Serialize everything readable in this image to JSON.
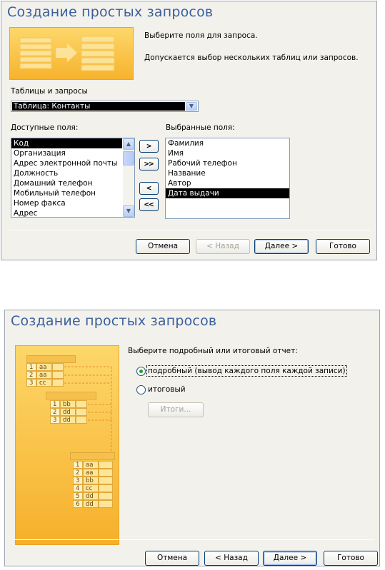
{
  "dialog1": {
    "title": "Создание простых запросов",
    "instruction1": "Выберите поля для запроса.",
    "instruction2": "Допускается выбор нескольких таблиц или запросов.",
    "tables_label": "Таблицы и запросы",
    "tables_value": "Таблица: Контакты",
    "available_label": "Доступные поля:",
    "selected_label": "Выбранные поля:",
    "available_fields": [
      "Код",
      "Организация",
      "Адрес электронной почты",
      "Должность",
      "Домашний телефон",
      "Мобильный телефон",
      "Номер факса",
      "Адрес"
    ],
    "selected_fields": [
      "Фамилия",
      "Имя",
      "Рабочий телефон",
      "Название",
      "Автор",
      "Дата выдачи"
    ],
    "move_buttons": [
      ">",
      ">>",
      "<",
      "<<"
    ],
    "buttons": {
      "cancel": "Отмена",
      "back": "< Назад",
      "next": "Далее >",
      "finish": "Готово"
    }
  },
  "dialog2": {
    "title": "Создание простых запросов",
    "prompt": "Выберите подробный или итоговый отчет:",
    "option_detail": "подробный (вывод каждого поля каждой записи)",
    "option_summary": "итоговый",
    "totals_button": "Итоги...",
    "buttons": {
      "cancel": "Отмена",
      "back": "< Назад",
      "next": "Далее >",
      "finish": "Готово"
    }
  },
  "illustration": {
    "table1": [
      [
        "1",
        "aa"
      ],
      [
        "2",
        "aa"
      ],
      [
        "3",
        "cc"
      ]
    ],
    "table2": [
      [
        "1",
        "bb"
      ],
      [
        "2",
        "dd"
      ],
      [
        "3",
        "dd"
      ]
    ],
    "table3": [
      [
        "1",
        "aa"
      ],
      [
        "2",
        "aa"
      ],
      [
        "3",
        "bb"
      ],
      [
        "4",
        "cc"
      ],
      [
        "5",
        "dd"
      ],
      [
        "6",
        "dd"
      ]
    ]
  },
  "colors": {
    "title": "#3b5f9e",
    "dialog_bg": "#f2f1eb",
    "illustration": "#f7b32e",
    "selection": "#000000"
  }
}
